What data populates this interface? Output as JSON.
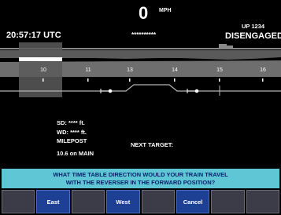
{
  "speed": {
    "value": "0",
    "unit": "MPH"
  },
  "clock": "20:57:17 UTC",
  "stars_top": "**********",
  "train_id": "UP 1234",
  "status": "DISENGAGED",
  "track": {
    "milepost_labels": [
      "10",
      "11",
      "13",
      "14",
      "15",
      "16"
    ]
  },
  "info": {
    "sd": "SD:  **** ft.",
    "wd": "WD:  **** ft.",
    "milepost_label": "MILEPOST",
    "milepost_value": "10.6 on MAIN",
    "next_target": "NEXT TARGET:"
  },
  "prompt": {
    "line1": "WHAT TIME TABLE DIRECTION WOULD YOUR TRAIN TRAVEL",
    "line2": "WITH THE REVERSER IN THE FORWARD POSITION?"
  },
  "softkeys": [
    "",
    "East",
    "",
    "West",
    "",
    "Cancel",
    "",
    ""
  ],
  "colors": {
    "track_band": "#6e6e6e",
    "track_line": "#b4b4b4",
    "train_marker": "#ffffff",
    "prompt_bg": "#5fc6d6",
    "prompt_text": "#0b1f6b",
    "key_active": "#1d3f94",
    "key_inactive": "#3c3c48"
  }
}
